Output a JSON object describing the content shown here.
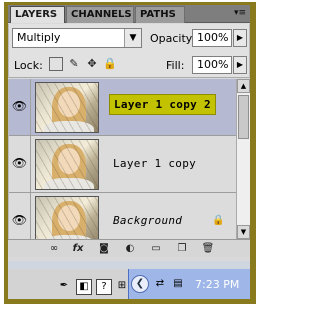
{
  "tabs": [
    {
      "label": "LAYERS",
      "active": true
    },
    {
      "label": "CHANNELS",
      "active": false
    },
    {
      "label": "PATHS",
      "active": false
    }
  ],
  "panel_menu_icon": "panel-menu-icon",
  "blend": {
    "mode": "Multiply",
    "opacity_label": "Opacity:",
    "opacity_value": "100%"
  },
  "lock": {
    "label": "Lock:",
    "fill_label": "Fill:",
    "fill_value": "100%"
  },
  "layers": [
    {
      "name": "Layer 1 copy 2",
      "selected": true,
      "visible": true
    },
    {
      "name": "Layer 1 copy",
      "selected": false,
      "visible": true
    },
    {
      "name": "Background",
      "selected": false,
      "visible": true,
      "locked": true
    }
  ],
  "toolbar_icons": [
    "link-layers-icon",
    "fx-icon",
    "mask-icon",
    "adjustment-icon",
    "group-icon",
    "new-layer-icon",
    "trash-icon"
  ],
  "taskbar": {
    "clock": "7:23 PM"
  },
  "colors": {
    "highlight": "#c3c200",
    "selected_row": "#b5b9d1",
    "frame": "#8a7a1e"
  }
}
